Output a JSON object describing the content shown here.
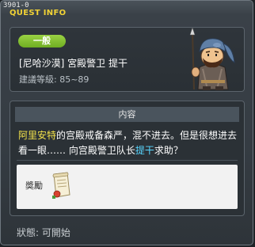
{
  "window": {
    "quest_id": "3901-0",
    "title": "QUEST INFO"
  },
  "quest": {
    "category": "一般",
    "name": "[尼哈沙漠] 宮殿警卫 提干",
    "required_level": "建議等級: 85~89"
  },
  "content": {
    "header": "内容",
    "text_part1": "阿里安特",
    "text_part2": "的宫殿戒备森严，混不进去。但是很想进去看一眼……  向宫殿警卫队长",
    "text_part3": "提干",
    "text_part4": "求助？"
  },
  "reward": {
    "label": "奬勵"
  },
  "status": {
    "text": "狀態: 可開始"
  },
  "colors": {
    "title_yellow": "#f2d335",
    "badge_green": "#8ac63a",
    "highlight_yellow": "#f2e14a",
    "highlight_cyan": "#58d6ff"
  },
  "icons": {
    "npc": "npc-portrait-icon",
    "reward": "scroll-reward-icon"
  }
}
